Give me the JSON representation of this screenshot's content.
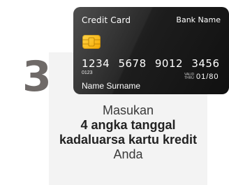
{
  "step": {
    "number": "3"
  },
  "card": {
    "title": "Credit Card",
    "bank": "Bank Name",
    "number": "1234 5678 9012 3456",
    "small_code": "0123",
    "valid_thru": "VALID THRU",
    "expiry": "01/80",
    "holder": "Name Surname"
  },
  "instruction": {
    "line1": "Masukan",
    "bold": "4 angka tanggal kadaluarsa kartu kredit",
    "line_end": " Anda"
  },
  "colors": {
    "panel": "#f3f3f3",
    "step_number": "#6f6a68",
    "card": "#1d1d1d",
    "chip": "#f4b400"
  }
}
